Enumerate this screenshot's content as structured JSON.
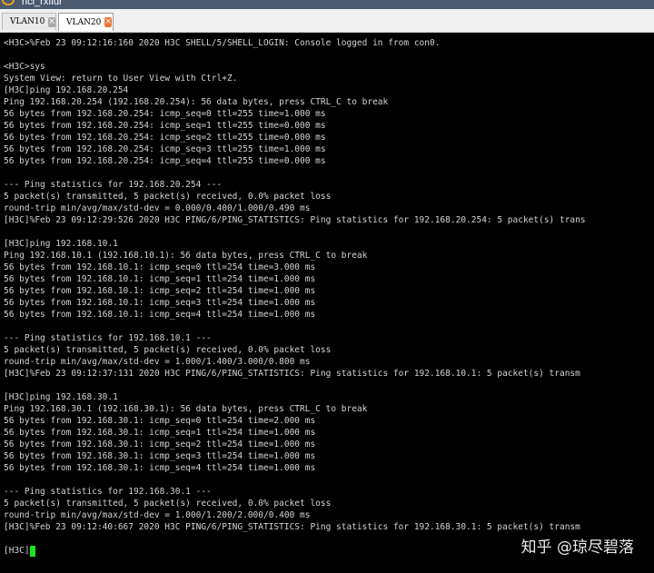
{
  "window": {
    "title": "hcl_rxflur"
  },
  "tabs": [
    {
      "label": "VLAN10",
      "close": "×"
    },
    {
      "label": "VLAN20",
      "close": "×"
    }
  ],
  "terminal": {
    "lines": [
      "<H3C>%Feb 23 09:12:16:160 2020 H3C SHELL/5/SHELL_LOGIN: Console logged in from con0.",
      "",
      "<H3C>sys",
      "System View: return to User View with Ctrl+Z.",
      "[H3C]ping 192.168.20.254",
      "Ping 192.168.20.254 (192.168.20.254): 56 data bytes, press CTRL_C to break",
      "56 bytes from 192.168.20.254: icmp_seq=0 ttl=255 time=1.000 ms",
      "56 bytes from 192.168.20.254: icmp_seq=1 ttl=255 time=0.000 ms",
      "56 bytes from 192.168.20.254: icmp_seq=2 ttl=255 time=0.000 ms",
      "56 bytes from 192.168.20.254: icmp_seq=3 ttl=255 time=1.000 ms",
      "56 bytes from 192.168.20.254: icmp_seq=4 ttl=255 time=0.000 ms",
      "",
      "--- Ping statistics for 192.168.20.254 ---",
      "5 packet(s) transmitted, 5 packet(s) received, 0.0% packet loss",
      "round-trip min/avg/max/std-dev = 0.000/0.400/1.000/0.490 ms",
      "[H3C]%Feb 23 09:12:29:526 2020 H3C PING/6/PING_STATISTICS: Ping statistics for 192.168.20.254: 5 packet(s) trans",
      "",
      "[H3C]ping 192.168.10.1",
      "Ping 192.168.10.1 (192.168.10.1): 56 data bytes, press CTRL_C to break",
      "56 bytes from 192.168.10.1: icmp_seq=0 ttl=254 time=3.000 ms",
      "56 bytes from 192.168.10.1: icmp_seq=1 ttl=254 time=1.000 ms",
      "56 bytes from 192.168.10.1: icmp_seq=2 ttl=254 time=1.000 ms",
      "56 bytes from 192.168.10.1: icmp_seq=3 ttl=254 time=1.000 ms",
      "56 bytes from 192.168.10.1: icmp_seq=4 ttl=254 time=1.000 ms",
      "",
      "--- Ping statistics for 192.168.10.1 ---",
      "5 packet(s) transmitted, 5 packet(s) received, 0.0% packet loss",
      "round-trip min/avg/max/std-dev = 1.000/1.400/3.000/0.800 ms",
      "[H3C]%Feb 23 09:12:37:131 2020 H3C PING/6/PING_STATISTICS: Ping statistics for 192.168.10.1: 5 packet(s) transm",
      "",
      "[H3C]ping 192.168.30.1",
      "Ping 192.168.30.1 (192.168.30.1): 56 data bytes, press CTRL_C to break",
      "56 bytes from 192.168.30.1: icmp_seq=0 ttl=254 time=2.000 ms",
      "56 bytes from 192.168.30.1: icmp_seq=1 ttl=254 time=1.000 ms",
      "56 bytes from 192.168.30.1: icmp_seq=2 ttl=254 time=1.000 ms",
      "56 bytes from 192.168.30.1: icmp_seq=3 ttl=254 time=1.000 ms",
      "56 bytes from 192.168.30.1: icmp_seq=4 ttl=254 time=1.000 ms",
      "",
      "--- Ping statistics for 192.168.30.1 ---",
      "5 packet(s) transmitted, 5 packet(s) received, 0.0% packet loss",
      "round-trip min/avg/max/std-dev = 1.000/1.200/2.000/0.400 ms",
      "[H3C]%Feb 23 09:12:40:667 2020 H3C PING/6/PING_STATISTICS: Ping statistics for 192.168.30.1: 5 packet(s) transm"
    ],
    "prompt": "[H3C]",
    "cursor_color": "#19e619"
  },
  "watermark": "知乎 @琼尽碧落"
}
